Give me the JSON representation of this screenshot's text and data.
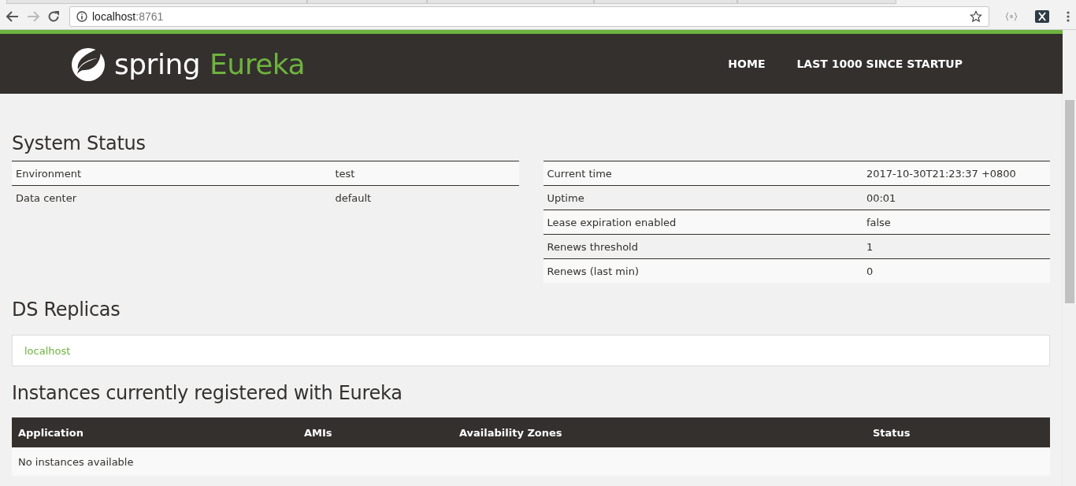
{
  "browser": {
    "url_host": "localhost",
    "url_port": ":8761"
  },
  "header": {
    "brand": "spring",
    "product": "Eureka",
    "nav": [
      {
        "label": "HOME"
      },
      {
        "label": "LAST 1000 SINCE STARTUP"
      }
    ]
  },
  "system_status": {
    "title": "System Status",
    "left": [
      {
        "name": "Environment",
        "value": "test"
      },
      {
        "name": "Data center",
        "value": "default"
      }
    ],
    "right": [
      {
        "name": "Current time",
        "value": "2017-10-30T21:23:37 +0800"
      },
      {
        "name": "Uptime",
        "value": "00:01"
      },
      {
        "name": "Lease expiration enabled",
        "value": "false"
      },
      {
        "name": "Renews threshold",
        "value": "1"
      },
      {
        "name": "Renews (last min)",
        "value": "0"
      }
    ]
  },
  "ds_replicas": {
    "title": "DS Replicas",
    "items": [
      "localhost"
    ]
  },
  "instances": {
    "title": "Instances currently registered with Eureka",
    "columns": [
      "Application",
      "AMIs",
      "Availability Zones",
      "Status"
    ],
    "empty_message": "No instances available"
  }
}
